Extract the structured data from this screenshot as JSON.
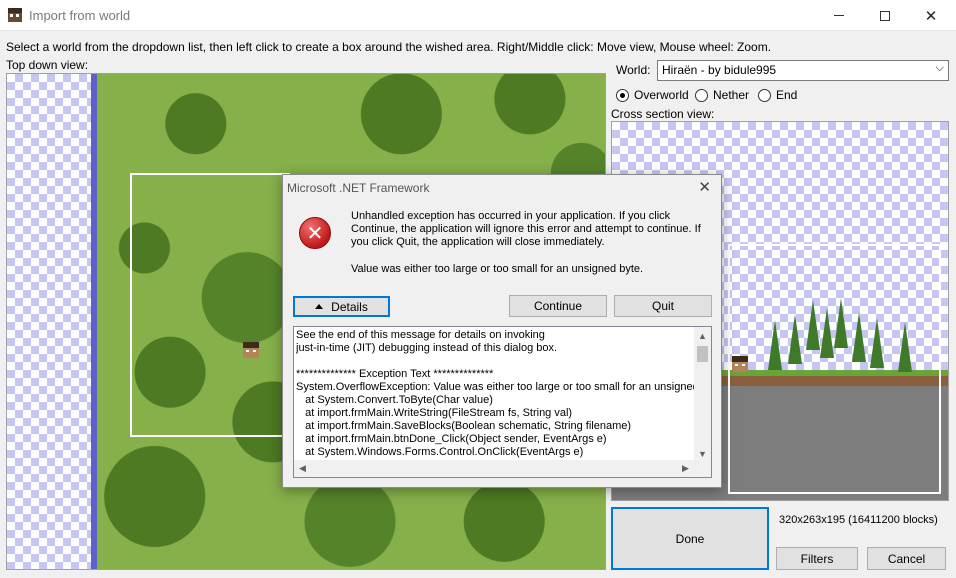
{
  "window": {
    "title": "Import from world",
    "min_icon": "minimize-icon",
    "max_icon": "maximize-icon",
    "close_icon": "close-icon"
  },
  "instructions": "Select a world from the dropdown list, then left click to create a box around the wished area. Right/Middle click: Move view, Mouse wheel: Zoom.",
  "topview": {
    "label": "Top down view:"
  },
  "world": {
    "label": "World:",
    "selected": "Hiraën - by bidule995"
  },
  "dimensions": [
    {
      "label": "Overworld",
      "checked": true
    },
    {
      "label": "Nether",
      "checked": false
    },
    {
      "label": "End",
      "checked": false
    }
  ],
  "crossview": {
    "label": "Cross section view:"
  },
  "buttons": {
    "done": "Done",
    "filters": "Filters",
    "cancel": "Cancel"
  },
  "blocks_info": "320x263x195 (16411200 blocks)",
  "dialog": {
    "title": "Microsoft .NET Framework",
    "close_glyph": "✕",
    "icon": "error-icon",
    "message": "Unhandled exception has occurred in your application. If you click Continue, the application will ignore this error and attempt to continue. If you click Quit, the application will close immediately.",
    "detail_message": "Value was either too large or too small for an unsigned byte.",
    "details_label": "Details",
    "continue_label": "Continue",
    "quit_label": "Quit",
    "details_text": "See the end of this message for details on invoking\njust-in-time (JIT) debugging instead of this dialog box.\n\n************** Exception Text **************\nSystem.OverflowException: Value was either too large or too small for an unsigned by\n   at System.Convert.ToByte(Char value)\n   at import.frmMain.WriteString(FileStream fs, String val)\n   at import.frmMain.SaveBlocks(Boolean schematic, String filename)\n   at import.frmMain.btnDone_Click(Object sender, EventArgs e)\n   at System.Windows.Forms.Control.OnClick(EventArgs e)"
  }
}
